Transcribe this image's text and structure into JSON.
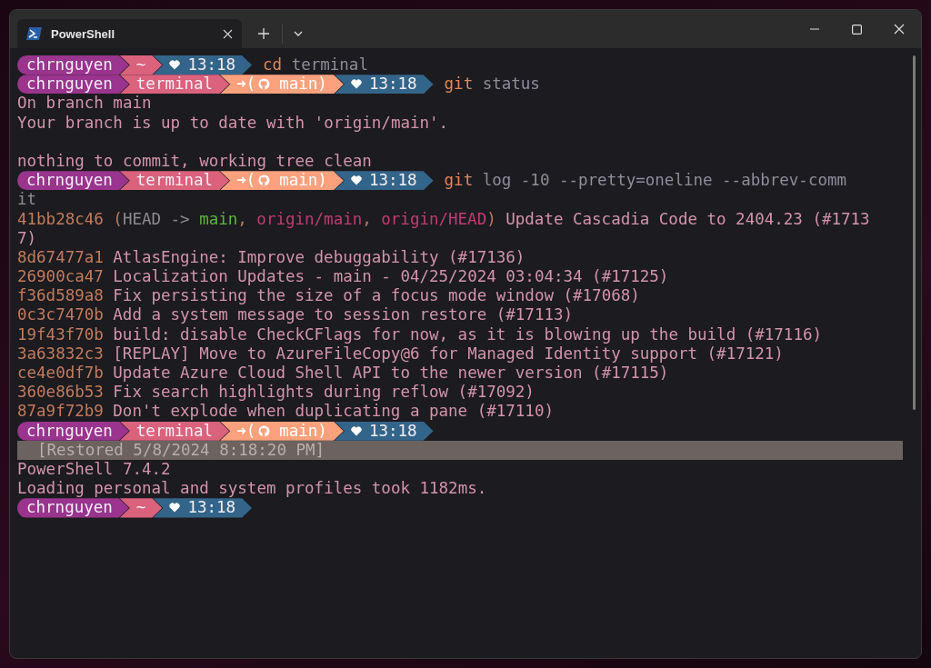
{
  "window": {
    "tabs": [
      {
        "title": "PowerShell",
        "selected": true
      }
    ]
  },
  "terminal": {
    "lines": [
      {
        "kind": "prompt",
        "segments": [
          {
            "kind": "user",
            "text": "chrnguyen"
          },
          {
            "kind": "path",
            "text": "~"
          },
          {
            "kind": "time",
            "text": "13:18"
          }
        ],
        "command": [
          {
            "kind": "cmd",
            "text": "cd"
          },
          {
            "kind": "arg",
            "text": "terminal"
          }
        ]
      },
      {
        "kind": "prompt",
        "segments": [
          {
            "kind": "user",
            "text": "chrnguyen"
          },
          {
            "kind": "path",
            "text": "terminal"
          },
          {
            "kind": "git",
            "prefix": "➜(",
            "text": "main)"
          },
          {
            "kind": "time",
            "text": "13:18"
          }
        ],
        "command": [
          {
            "kind": "cmd",
            "text": "git"
          },
          {
            "kind": "arg",
            "text": "status"
          }
        ]
      },
      {
        "kind": "text",
        "segments": [
          {
            "kind": "out",
            "text": "On branch main"
          }
        ]
      },
      {
        "kind": "text",
        "segments": [
          {
            "kind": "out",
            "text": "Your branch is up to date with 'origin/main'."
          }
        ]
      },
      {
        "kind": "blank"
      },
      {
        "kind": "text",
        "segments": [
          {
            "kind": "out",
            "text": "nothing to commit, working tree clean"
          }
        ]
      },
      {
        "kind": "prompt",
        "segments": [
          {
            "kind": "user",
            "text": "chrnguyen"
          },
          {
            "kind": "path",
            "text": "terminal"
          },
          {
            "kind": "git",
            "prefix": "➜(",
            "text": "main)"
          },
          {
            "kind": "time",
            "text": "13:18"
          }
        ],
        "command": [
          {
            "kind": "cmd",
            "text": "git"
          },
          {
            "kind": "arg",
            "text": "log -10 --pretty=oneline --abbrev-comm"
          }
        ]
      },
      {
        "kind": "text",
        "segments": [
          {
            "kind": "arg",
            "text": "it"
          }
        ]
      },
      {
        "kind": "text",
        "segments": [
          {
            "kind": "hash",
            "text": "41bb28c46"
          },
          {
            "kind": "paren",
            "text": "("
          },
          {
            "kind": "head",
            "text": "HEAD ->"
          },
          {
            "kind": "local",
            "text": "main"
          },
          {
            "kind": "paren",
            "text": ","
          },
          {
            "kind": "remote",
            "text": "origin/main"
          },
          {
            "kind": "paren",
            "text": ","
          },
          {
            "kind": "remote",
            "text": "origin/HEAD"
          },
          {
            "kind": "paren",
            "text": ")"
          },
          {
            "kind": "out",
            "text": "Update Cascadia Code to 2404.23 (#1713"
          }
        ]
      },
      {
        "kind": "text",
        "segments": [
          {
            "kind": "out",
            "text": "7)"
          }
        ]
      },
      {
        "kind": "text",
        "segments": [
          {
            "kind": "hash",
            "text": "8d67477a1"
          },
          {
            "kind": "out",
            "text": "AtlasEngine: Improve debuggability (#17136)"
          }
        ]
      },
      {
        "kind": "text",
        "segments": [
          {
            "kind": "hash",
            "text": "26900ca47"
          },
          {
            "kind": "out",
            "text": "Localization Updates - main - 04/25/2024 03:04:34 (#17125)"
          }
        ]
      },
      {
        "kind": "text",
        "segments": [
          {
            "kind": "hash",
            "text": "f36d589a8"
          },
          {
            "kind": "out",
            "text": "Fix persisting the size of a focus mode window (#17068)"
          }
        ]
      },
      {
        "kind": "text",
        "segments": [
          {
            "kind": "hash",
            "text": "0c3c7470b"
          },
          {
            "kind": "out",
            "text": "Add a system message to session restore (#17113)"
          }
        ]
      },
      {
        "kind": "text",
        "segments": [
          {
            "kind": "hash",
            "text": "19f43f70b"
          },
          {
            "kind": "out",
            "text": "build: disable CheckCFlags for now, as it is blowing up the build (#17116)"
          }
        ]
      },
      {
        "kind": "text",
        "segments": [
          {
            "kind": "hash",
            "text": "3a63832c3"
          },
          {
            "kind": "out",
            "text": "[REPLAY] Move to AzureFileCopy@6 for Managed Identity support (#17121)"
          }
        ]
      },
      {
        "kind": "text",
        "segments": [
          {
            "kind": "hash",
            "text": "ce4e0df7b"
          },
          {
            "kind": "out",
            "text": "Update Azure Cloud Shell API to the newer version (#17115)"
          }
        ]
      },
      {
        "kind": "text",
        "segments": [
          {
            "kind": "hash",
            "text": "360e86b53"
          },
          {
            "kind": "out",
            "text": "Fix search highlights during reflow (#17092)"
          }
        ]
      },
      {
        "kind": "text",
        "segments": [
          {
            "kind": "hash",
            "text": "87a9f72b9"
          },
          {
            "kind": "out",
            "text": "Don't explode when duplicating a pane (#17110)"
          }
        ]
      },
      {
        "kind": "prompt",
        "segments": [
          {
            "kind": "user",
            "text": "chrnguyen"
          },
          {
            "kind": "path",
            "text": "terminal"
          },
          {
            "kind": "git",
            "prefix": "➜(",
            "text": "main)"
          },
          {
            "kind": "time",
            "text": "13:18"
          }
        ]
      },
      {
        "kind": "restored",
        "text": "[Restored 5/8/2024 8:18:20 PM]"
      },
      {
        "kind": "text",
        "segments": [
          {
            "kind": "out",
            "text": "PowerShell 7.4.2"
          }
        ]
      },
      {
        "kind": "text",
        "segments": [
          {
            "kind": "out",
            "text": "Loading personal and system profiles took 1182ms."
          }
        ]
      },
      {
        "kind": "prompt",
        "segments": [
          {
            "kind": "user",
            "text": "chrnguyen"
          },
          {
            "kind": "path",
            "text": "~"
          },
          {
            "kind": "time",
            "text": "13:18"
          }
        ]
      }
    ]
  }
}
